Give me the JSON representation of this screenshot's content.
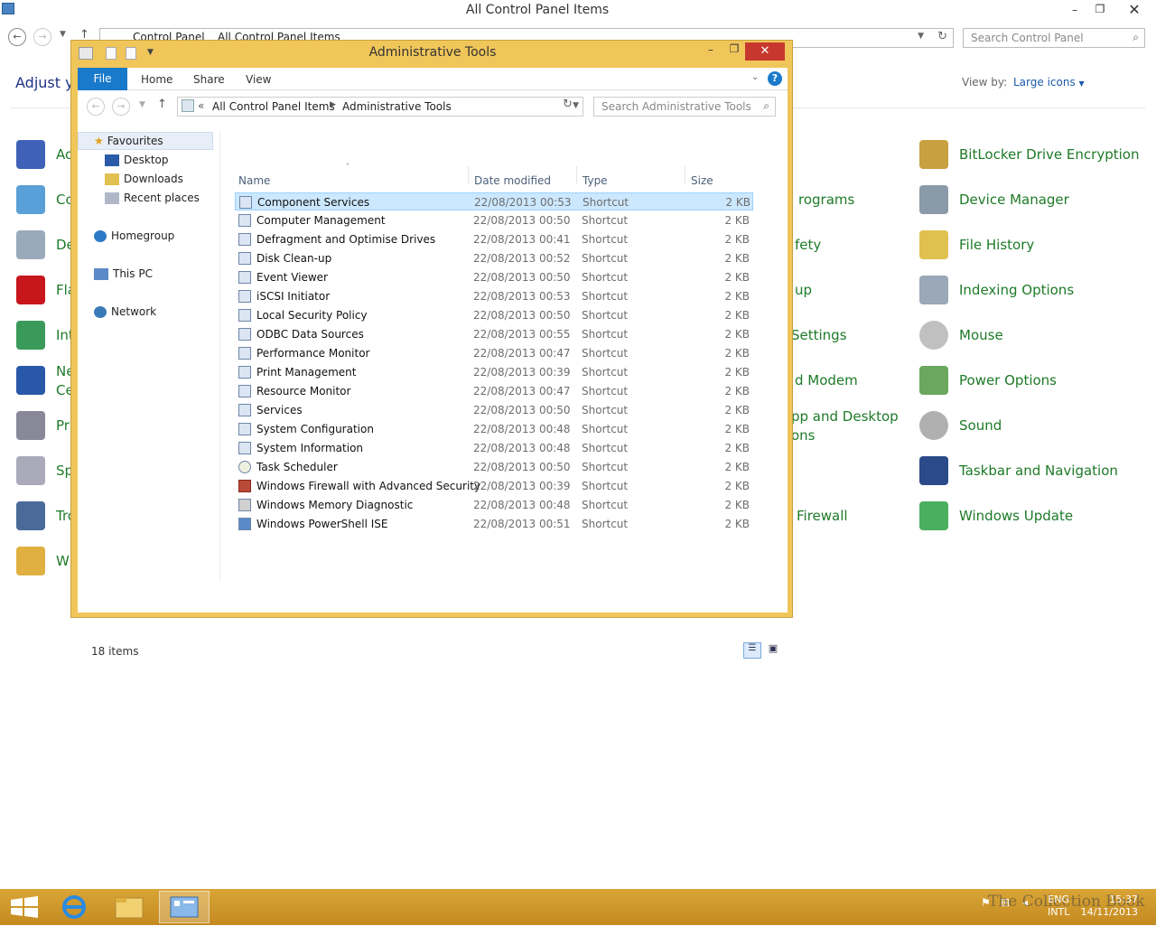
{
  "background_window": {
    "title": "All Control Panel Items",
    "breadcrumb": [
      "Control Panel",
      "All Control Panel Items"
    ],
    "search_placeholder": "Search Control Panel",
    "heading_partial": "Adjust yo",
    "view_by_label": "View by:",
    "view_by_value": "Large icons",
    "left_column_partial": [
      "Ac",
      "Co",
      "De",
      "Fla",
      "Int",
      "Ne",
      "Ce",
      "Pr",
      "Sp",
      "Tro",
      "W"
    ],
    "middle_column_partial": [
      "rograms",
      "fety",
      "up",
      "Settings",
      "d Modem",
      "pp and Desktop",
      "ons",
      "Firewall"
    ],
    "right_column": [
      "BitLocker Drive Encryption",
      "Device Manager",
      "File History",
      "Indexing Options",
      "Mouse",
      "Power Options",
      "Sound",
      "Taskbar and Navigation",
      "Windows Update"
    ]
  },
  "explorer": {
    "title": "Administrative Tools",
    "ribbon_tabs": [
      "File",
      "Home",
      "Share",
      "View"
    ],
    "address_prefix": "«",
    "address_parts": [
      "All Control Panel Items",
      "Administrative Tools"
    ],
    "search_placeholder": "Search Administrative Tools",
    "nav_pane": [
      "Favourites",
      "Desktop",
      "Downloads",
      "Recent places",
      "Homegroup",
      "This PC",
      "Network"
    ],
    "columns": [
      "Name",
      "Date modified",
      "Type",
      "Size"
    ],
    "files": [
      {
        "name": "Component Services",
        "date": "22/08/2013 00:53",
        "type": "Shortcut",
        "size": "2 KB"
      },
      {
        "name": "Computer Management",
        "date": "22/08/2013 00:50",
        "type": "Shortcut",
        "size": "2 KB"
      },
      {
        "name": "Defragment and Optimise Drives",
        "date": "22/08/2013 00:41",
        "type": "Shortcut",
        "size": "2 KB"
      },
      {
        "name": "Disk Clean-up",
        "date": "22/08/2013 00:52",
        "type": "Shortcut",
        "size": "2 KB"
      },
      {
        "name": "Event Viewer",
        "date": "22/08/2013 00:50",
        "type": "Shortcut",
        "size": "2 KB"
      },
      {
        "name": "iSCSI Initiator",
        "date": "22/08/2013 00:53",
        "type": "Shortcut",
        "size": "2 KB"
      },
      {
        "name": "Local Security Policy",
        "date": "22/08/2013 00:50",
        "type": "Shortcut",
        "size": "2 KB"
      },
      {
        "name": "ODBC Data Sources",
        "date": "22/08/2013 00:55",
        "type": "Shortcut",
        "size": "2 KB"
      },
      {
        "name": "Performance Monitor",
        "date": "22/08/2013 00:47",
        "type": "Shortcut",
        "size": "2 KB"
      },
      {
        "name": "Print Management",
        "date": "22/08/2013 00:39",
        "type": "Shortcut",
        "size": "2 KB"
      },
      {
        "name": "Resource Monitor",
        "date": "22/08/2013 00:47",
        "type": "Shortcut",
        "size": "2 KB"
      },
      {
        "name": "Services",
        "date": "22/08/2013 00:50",
        "type": "Shortcut",
        "size": "2 KB"
      },
      {
        "name": "System Configuration",
        "date": "22/08/2013 00:48",
        "type": "Shortcut",
        "size": "2 KB"
      },
      {
        "name": "System Information",
        "date": "22/08/2013 00:48",
        "type": "Shortcut",
        "size": "2 KB"
      },
      {
        "name": "Task Scheduler",
        "date": "22/08/2013 00:50",
        "type": "Shortcut",
        "size": "2 KB"
      },
      {
        "name": "Windows Firewall with Advanced Security",
        "date": "22/08/2013 00:39",
        "type": "Shortcut",
        "size": "2 KB"
      },
      {
        "name": "Windows Memory Diagnostic",
        "date": "22/08/2013 00:48",
        "type": "Shortcut",
        "size": "2 KB"
      },
      {
        "name": "Windows PowerShell ISE",
        "date": "22/08/2013 00:51",
        "type": "Shortcut",
        "size": "2 KB"
      }
    ],
    "status": "18 items"
  },
  "taskbar": {
    "lang_top": "ENG",
    "lang_bottom": "INTL",
    "time": "15:37",
    "date": "14/11/2013",
    "watermark": "The Collection Book"
  },
  "colors": {
    "accent": "#f0c65a",
    "file_tab": "#1979ca",
    "close": "#c8372d",
    "cp_link": "#1e7a28"
  }
}
